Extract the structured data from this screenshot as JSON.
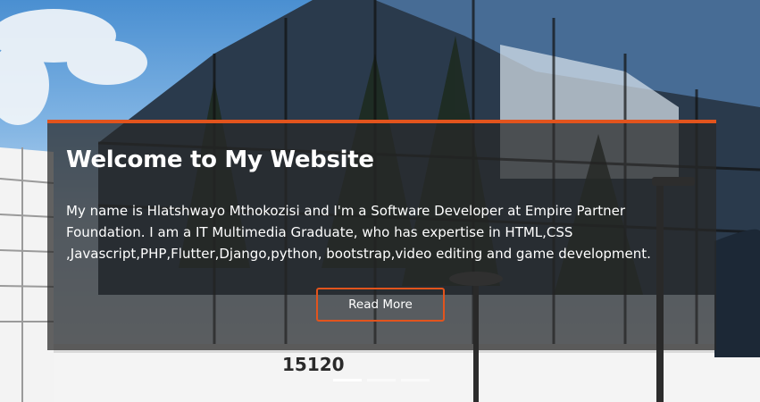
{
  "hero": {
    "title": "Welcome to My Website",
    "description": "My name is Hlatshwayo Mthokozisi and I'm a Software Developer at Empire Partner Foundation. I am a IT Multimedia Graduate, who has expertise in HTML,CSS ,Javascript,PHP,Flutter,Django,python, bootstrap,video editing and game development.",
    "button_label": "Read More",
    "building_number": "15120",
    "accent_color": "#e2541d",
    "slides": [
      {
        "active": true
      },
      {
        "active": false
      },
      {
        "active": false
      }
    ]
  }
}
